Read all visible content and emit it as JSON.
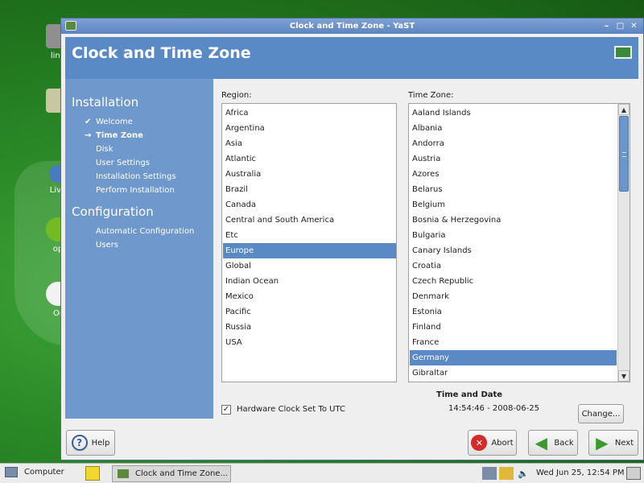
{
  "desktop": {
    "icons": [
      {
        "label": "linu",
        "icon": "computer-icon"
      },
      {
        "label": "",
        "icon": "trash-icon"
      },
      {
        "label": "Live",
        "icon": "live-icon"
      },
      {
        "label": "op",
        "icon": "opensuse-icon"
      },
      {
        "label": "Or",
        "icon": "openoffice-icon"
      }
    ]
  },
  "window": {
    "title": "Clock and Time Zone - YaST",
    "header_title": "Clock and Time Zone"
  },
  "sidebar": {
    "section1": "Installation",
    "steps1": [
      {
        "label": "Welcome",
        "mark": "✔"
      },
      {
        "label": "Time Zone",
        "mark": "→"
      },
      {
        "label": "Disk",
        "mark": ""
      },
      {
        "label": "User Settings",
        "mark": ""
      },
      {
        "label": "Installation Settings",
        "mark": ""
      },
      {
        "label": "Perform Installation",
        "mark": ""
      }
    ],
    "section2": "Configuration",
    "steps2": [
      {
        "label": "Automatic Configuration"
      },
      {
        "label": "Users"
      }
    ]
  },
  "region": {
    "label": "Region:",
    "items": [
      "Africa",
      "Argentina",
      "Asia",
      "Atlantic",
      "Australia",
      "Brazil",
      "Canada",
      "Central and South America",
      "Etc",
      "Europe",
      "Global",
      "Indian Ocean",
      "Mexico",
      "Pacific",
      "Russia",
      "USA"
    ],
    "selected": "Europe"
  },
  "timezone": {
    "label": "Time Zone:",
    "items": [
      "Aaland Islands",
      "Albania",
      "Andorra",
      "Austria",
      "Azores",
      "Belarus",
      "Belgium",
      "Bosnia & Herzegovina",
      "Bulgaria",
      "Canary Islands",
      "Croatia",
      "Czech Republic",
      "Denmark",
      "Estonia",
      "Finland",
      "France",
      "Germany",
      "Gibraltar"
    ],
    "selected": "Germany"
  },
  "hw_clock": {
    "label": "Hardware Clock Set To UTC",
    "checked": true
  },
  "time_date": {
    "heading": "Time and Date",
    "value": "14:54:46 - 2008-06-25",
    "change_label": "Change..."
  },
  "buttons": {
    "help": "Help",
    "abort": "Abort",
    "back": "Back",
    "next": "Next"
  },
  "panel": {
    "computer_label": "Computer",
    "task_label": "Clock and Time Zone...",
    "clock": "Wed Jun 25, 12:54 PM"
  },
  "colors": {
    "accent": "#5a8ac6",
    "sidebar": "#6f98cd",
    "desktop": "#2a8a26"
  }
}
